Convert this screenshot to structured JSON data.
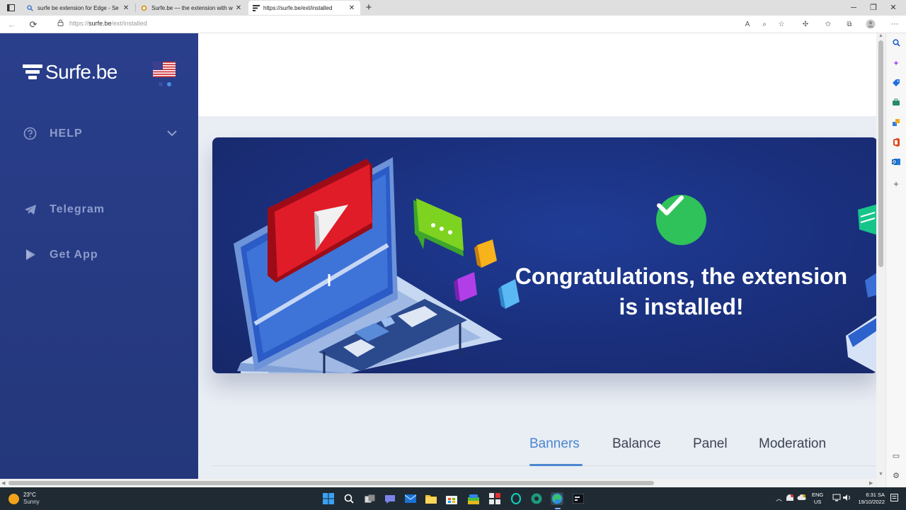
{
  "browser": {
    "tabs": [
      {
        "label": "surfe be extension for Edge - Se",
        "icon": "search-icon"
      },
      {
        "label": "Surfe.be — the extension with w",
        "icon": "site-favicon"
      },
      {
        "label": "https://surfe.be/ext/installed",
        "icon": "surfe-favicon",
        "active": true
      }
    ],
    "new_tab": "+",
    "address": {
      "prefix": "https://",
      "host": "surfe.be",
      "path": "/ext/installed"
    },
    "window_controls": [
      "minimize",
      "maximize",
      "close"
    ]
  },
  "sidebar": {
    "logo_text": "Surfe.be",
    "flag": "us-flag",
    "menu": [
      {
        "label": "HELP",
        "icon": "help-circle-icon",
        "expandable": true
      },
      {
        "label": "Telegram",
        "icon": "telegram-icon"
      },
      {
        "label": "Get App",
        "icon": "play-icon"
      }
    ]
  },
  "hero": {
    "title_line1": "Congratulations, the extension",
    "title_line2": "is installed!",
    "icon": "checkmark-icon",
    "accent": "#2fc25a"
  },
  "page_tabs": [
    {
      "label": "Banners",
      "active": true
    },
    {
      "label": "Balance"
    },
    {
      "label": "Panel"
    },
    {
      "label": "Moderation"
    }
  ],
  "colors": {
    "sidebar": "#263a82",
    "accent": "#4a86cf",
    "hero_bg": "#1a2f7c"
  },
  "taskbar": {
    "weather_temp": "23°C",
    "weather_desc": "Sunny",
    "lang_line1": "ENG",
    "lang_line2": "US",
    "time": "6:31 SA",
    "date": "19/10/2022"
  }
}
